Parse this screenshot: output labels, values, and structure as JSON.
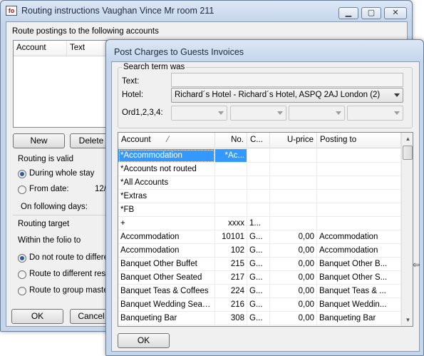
{
  "back_window": {
    "title": "Routing instructions Vaughan Vince Mr room 211",
    "logo": "fo",
    "route_label": "Route postings to the following accounts",
    "columns": [
      "Account",
      "Text"
    ],
    "new_label": "New",
    "delete_label": "Delete",
    "routing_valid_label": "Routing is valid",
    "during_whole_stay_label": "During whole stay",
    "from_date_label": "From date:",
    "from_date_value": "12/",
    "on_following_days_label": "On following days:",
    "routing_target_label": "Routing target",
    "within_folio_label": "Within the folio to",
    "do_not_route_label": "Do not route to differen",
    "route_reservation_label": "Route to different reser",
    "route_group_label": "Route to group master",
    "ok_label": "OK",
    "cancel_label": "Cancel"
  },
  "front_window": {
    "title": "Post Charges to Guests Invoices",
    "search_group_label": "Search term was",
    "text_label": "Text:",
    "text_value": "",
    "hotel_label": "Hotel:",
    "hotel_value": "Richard´s Hotel - Richard´s Hotel, ASPQ 2AJ London  (2)",
    "ord_label": "Ord1,2,3,4:",
    "grid": {
      "columns": [
        "Account",
        "No.",
        "C...",
        "U-price",
        "Posting to"
      ],
      "sort_indicator": "⁄",
      "rows": [
        {
          "account": "*Accommodation",
          "no": "*Ac...",
          "c": "",
          "price": "",
          "posting": ""
        },
        {
          "account": "*Accounts not routed",
          "no": "",
          "c": "",
          "price": "",
          "posting": ""
        },
        {
          "account": "*All Accounts",
          "no": "",
          "c": "",
          "price": "",
          "posting": ""
        },
        {
          "account": "*Extras",
          "no": "",
          "c": "",
          "price": "",
          "posting": ""
        },
        {
          "account": "*FB",
          "no": "",
          "c": "",
          "price": "",
          "posting": ""
        },
        {
          "account": "+",
          "no": "xxxx",
          "c": "1...",
          "price": "",
          "posting": ""
        },
        {
          "account": "Accommodation",
          "no": "10101",
          "c": "G...",
          "price": "0,00",
          "posting": "Accommodation"
        },
        {
          "account": "Accommodation",
          "no": "102",
          "c": "G...",
          "price": "0,00",
          "posting": "Accommodation"
        },
        {
          "account": "Banquet Other Buffet",
          "no": "215",
          "c": "G...",
          "price": "0,00",
          "posting": "Banquet Other B..."
        },
        {
          "account": "Banquet Other Seated",
          "no": "217",
          "c": "G...",
          "price": "0,00",
          "posting": "Banquet Other S..."
        },
        {
          "account": "Banquet Teas & Coffees",
          "no": "224",
          "c": "G...",
          "price": "0,00",
          "posting": "Banquet Teas & ..."
        },
        {
          "account": "Banquet Wedding Seated",
          "no": "216",
          "c": "G...",
          "price": "0,00",
          "posting": "Banquet Weddin..."
        },
        {
          "account": "Banqueting Bar",
          "no": "308",
          "c": "G...",
          "price": "0,00",
          "posting": "Banqueting Bar"
        }
      ]
    },
    "ok_label": "OK"
  }
}
